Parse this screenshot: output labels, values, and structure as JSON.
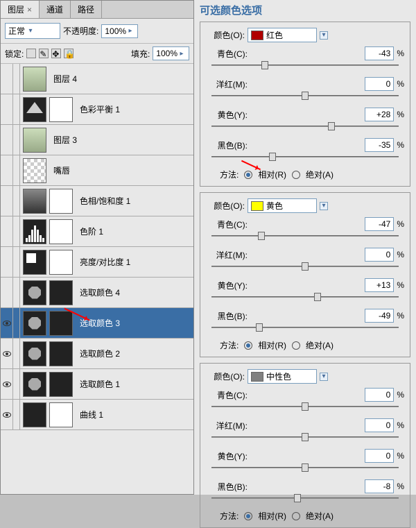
{
  "tabs": {
    "layers": "图层",
    "channels": "通道",
    "paths": "路径"
  },
  "blend": {
    "mode": "正常",
    "opacity_label": "不透明度:",
    "opacity": "100%",
    "lock_label": "锁定:",
    "fill_label": "填充:",
    "fill": "100%"
  },
  "layers": [
    {
      "name": "图层 4",
      "type": "img",
      "eye": false
    },
    {
      "name": "色彩平衡 1",
      "type": "adj",
      "eye": false
    },
    {
      "name": "图层 3",
      "type": "img",
      "eye": false
    },
    {
      "name": "嘴唇",
      "type": "checker",
      "eye": false
    },
    {
      "name": "色相/饱和度 1",
      "type": "grad",
      "eye": false
    },
    {
      "name": "色阶 1",
      "type": "hist",
      "eye": false
    },
    {
      "name": "亮度/对比度 1",
      "type": "bc",
      "eye": false
    },
    {
      "name": "选取颜色 4",
      "type": "oct",
      "eye": false
    },
    {
      "name": "选取颜色 3",
      "type": "oct",
      "eye": true,
      "selected": true
    },
    {
      "name": "选取颜色 2",
      "type": "oct",
      "eye": true
    },
    {
      "name": "选取颜色 1",
      "type": "oct",
      "eye": true
    },
    {
      "name": "曲线 1",
      "type": "curve",
      "eye": true
    }
  ],
  "right_title": "可选颜色选项",
  "labels": {
    "color": "颜色(O):",
    "cyan": "青色(C):",
    "magenta": "洋红(M):",
    "yellow": "黄色(Y):",
    "black": "黑色(B):",
    "method": "方法:",
    "relative": "相对(R)",
    "absolute": "绝对(A)",
    "pct": "%"
  },
  "sections": [
    {
      "color_name": "红色",
      "swatch": "#b00000",
      "c": "-43",
      "m": "0",
      "y": "+28",
      "k": "-35"
    },
    {
      "color_name": "黄色",
      "swatch": "#ffff00",
      "c": "-47",
      "m": "0",
      "y": "+13",
      "k": "-49"
    },
    {
      "color_name": "中性色",
      "swatch": "#808080",
      "c": "0",
      "m": "0",
      "y": "0",
      "k": "-8"
    }
  ]
}
